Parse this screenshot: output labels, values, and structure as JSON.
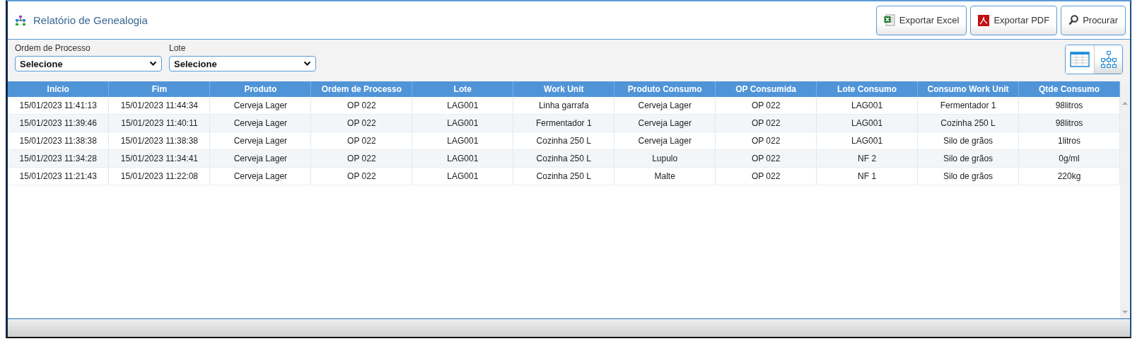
{
  "window": {
    "title": "Relatório de Genealogia"
  },
  "buttons": [
    {
      "kind": "excel",
      "label": "Exportar Excel"
    },
    {
      "kind": "pdf",
      "label": "Exportar PDF"
    },
    {
      "kind": "search",
      "label": "Procurar"
    }
  ],
  "filters": [
    {
      "label": "Ordem de Processo",
      "value": "Selecione"
    },
    {
      "label": "Lote",
      "value": "Selecione"
    }
  ],
  "view_toggles": [
    {
      "kind": "table",
      "selected": true
    },
    {
      "kind": "tree",
      "selected": false
    }
  ],
  "table": {
    "columns": [
      "Início",
      "Fim",
      "Produto",
      "Ordem de Processo",
      "Lote",
      "Work Unit",
      "Produto Consumo",
      "OP Consumida",
      "Lote Consumo",
      "Consumo Work Unit",
      "Qtde Consumo"
    ],
    "rows": [
      [
        "15/01/2023 11:41:13",
        "15/01/2023 11:44:34",
        "Cerveja Lager",
        "OP 022",
        "LAG001",
        "Linha garrafa",
        "Cerveja Lager",
        "OP 022",
        "LAG001",
        "Fermentador 1",
        "98litros"
      ],
      [
        "15/01/2023 11:39:46",
        "15/01/2023 11:40:11",
        "Cerveja Lager",
        "OP 022",
        "LAG001",
        "Fermentador 1",
        "Cerveja Lager",
        "OP 022",
        "LAG001",
        "Cozinha 250 L",
        "98litros"
      ],
      [
        "15/01/2023 11:38:38",
        "15/01/2023 11:38:38",
        "Cerveja Lager",
        "OP 022",
        "LAG001",
        "Cozinha 250 L",
        "Cerveja Lager",
        "OP 022",
        "LAG001",
        "Silo de grãos",
        "1litros"
      ],
      [
        "15/01/2023 11:34:28",
        "15/01/2023 11:34:41",
        "Cerveja Lager",
        "OP 022",
        "LAG001",
        "Cozinha 250 L",
        "Lupulo",
        "OP 022",
        "NF 2",
        "Silo de grãos",
        "0g/ml"
      ],
      [
        "15/01/2023 11:21:43",
        "15/01/2023 11:22:08",
        "Cerveja Lager",
        "OP 022",
        "LAG001",
        "Cozinha 250 L",
        "Malte",
        "OP 022",
        "NF 1",
        "Silo de grãos",
        "220kg"
      ]
    ]
  }
}
